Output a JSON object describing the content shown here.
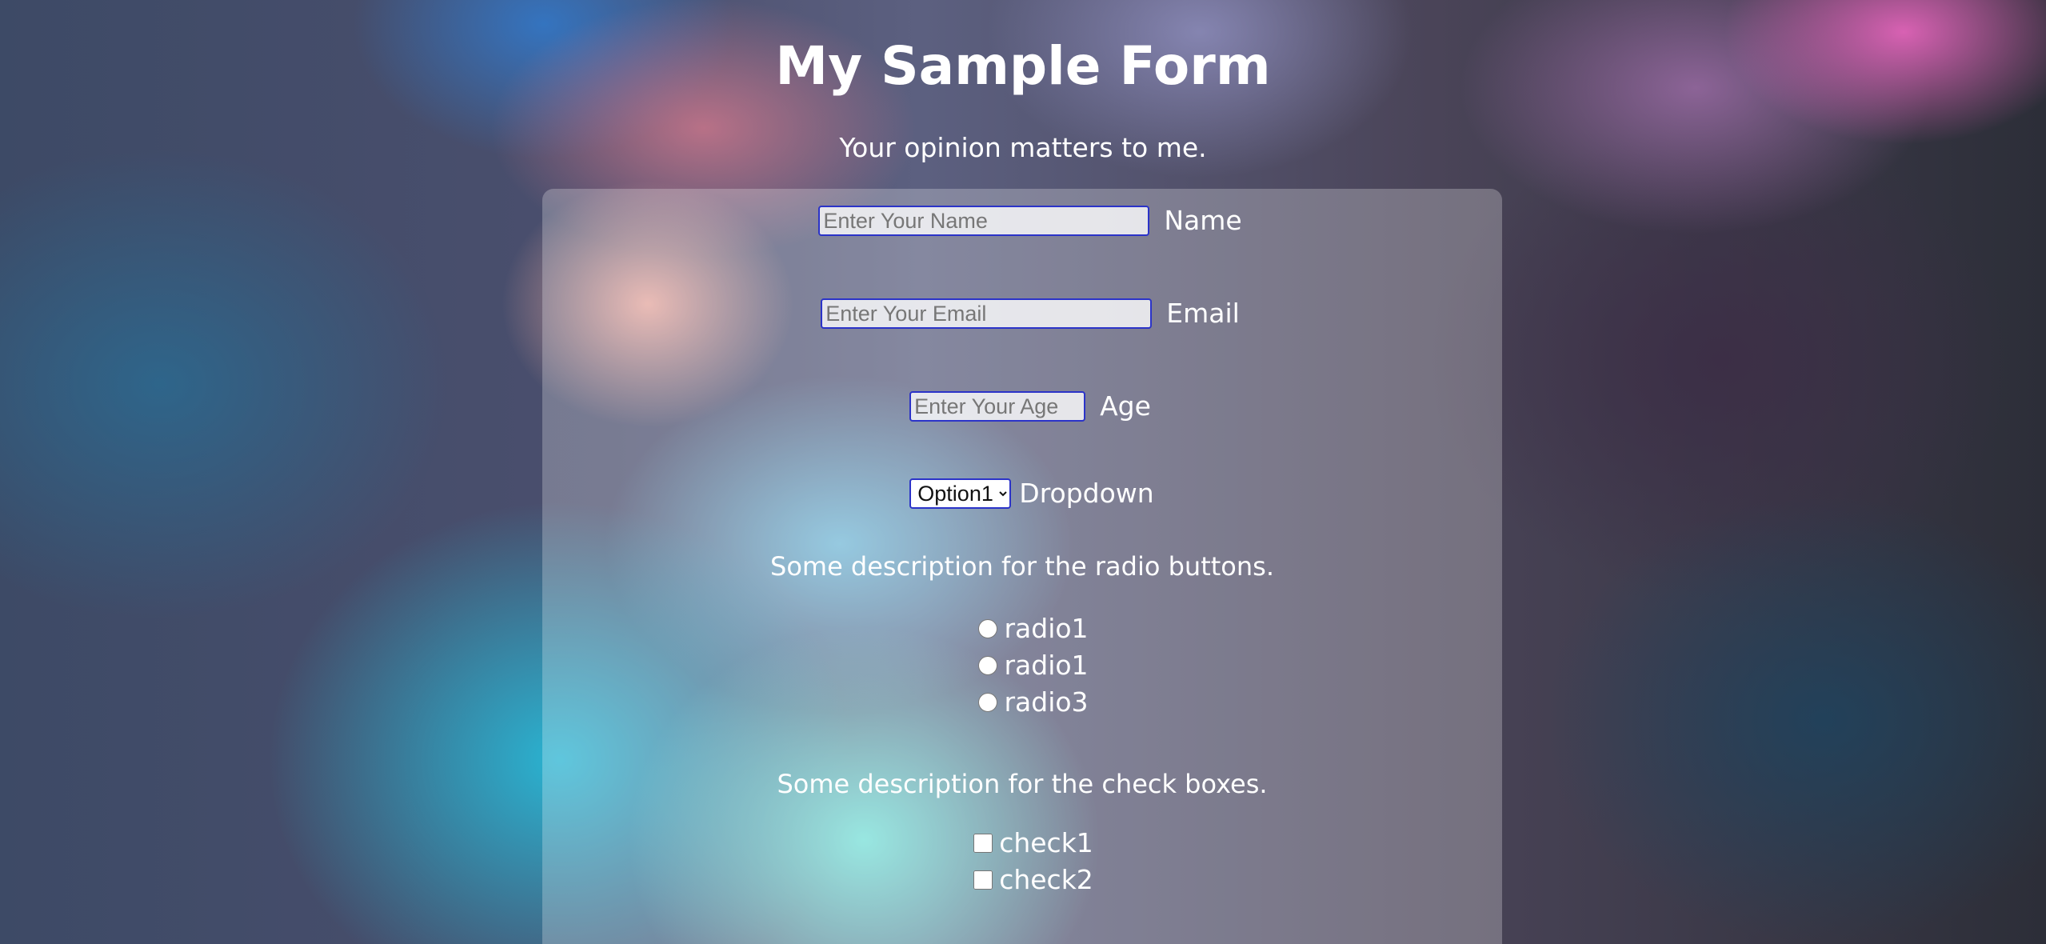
{
  "header": {
    "title": "My Sample Form",
    "subtitle": "Your opinion matters to me."
  },
  "form": {
    "name": {
      "placeholder": "Enter Your Name",
      "value": "",
      "label": "Name"
    },
    "email": {
      "placeholder": "Enter Your Email",
      "value": "",
      "label": "Email"
    },
    "age": {
      "placeholder": "Enter Your Age",
      "value": "",
      "label": "Age"
    },
    "dropdown": {
      "selected": "Option1",
      "label": "Dropdown"
    },
    "radio_description": "Some description for the radio buttons.",
    "radios": [
      {
        "label": "radio1",
        "checked": false
      },
      {
        "label": "radio1",
        "checked": false
      },
      {
        "label": "radio3",
        "checked": false
      }
    ],
    "checkbox_description": "Some description for the check boxes.",
    "checkboxes": [
      {
        "label": "check1",
        "checked": false
      },
      {
        "label": "check2",
        "checked": false
      }
    ]
  },
  "colors": {
    "input_border": "#2b33c8",
    "text": "#ffffff"
  }
}
